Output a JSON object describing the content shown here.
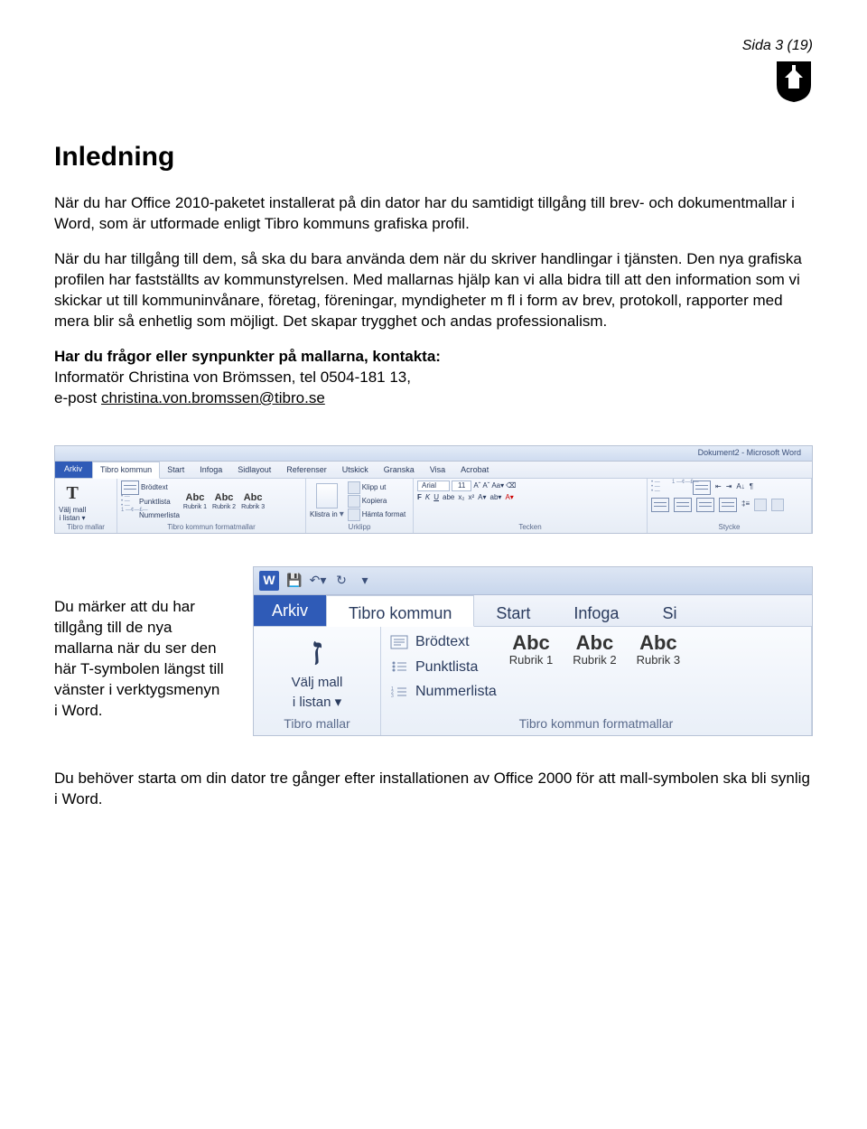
{
  "header": {
    "page_label": "Sida 3 (19)"
  },
  "title": "Inledning",
  "paragraphs": {
    "p1": "När du har Office 2010-paketet installerat på din dator har du samtidigt tillgång till brev- och dokumentmallar i Word, som är utformade enligt Tibro kommuns grafiska profil.",
    "p2": "När du har tillgång till dem, så ska du bara använda dem när du skriver handlingar i tjänsten. Den nya grafiska profilen har fastställts av kommunstyrelsen. Med mallarnas hjälp kan vi alla bidra till att den information som vi skickar ut till kommuninvånare, företag, föreningar, myndigheter m fl i form av brev, protokoll, rapporter med mera blir så enhetlig som möjligt. Det skapar trygghet och andas professionalism.",
    "contact_heading": "Har du frågor eller synpunkter på mallarna, kontakta:",
    "contact_line1": "Informatör Christina von Brömssen, tel 0504-181 13,",
    "contact_line2a": "e-post ",
    "contact_email": "christina.von.bromssen@tibro.se"
  },
  "ribbon": {
    "window_title": "Dokument2 - Microsoft Word",
    "tabs": [
      "Arkiv",
      "Tibro kommun",
      "Start",
      "Infoga",
      "Sidlayout",
      "Referenser",
      "Utskick",
      "Granska",
      "Visa",
      "Acrobat"
    ],
    "group1": {
      "valj": "Välj mall",
      "ilistan": "i listan ▾",
      "list": [
        "Brödtext",
        "Punktlista",
        "Nummerlista"
      ],
      "label1": "Tibro mallar",
      "abc_cols": [
        {
          "top": "Abc",
          "sub": "Rubrik 1"
        },
        {
          "top": "Abc",
          "sub": "Rubrik 2"
        },
        {
          "top": "Abc",
          "sub": "Rubrik 3"
        }
      ],
      "label2": "Tibro kommun formatmallar"
    },
    "clip": {
      "paste": "Klistra in",
      "cut": "Klipp ut",
      "copy": "Kopiera",
      "format": "Hämta format",
      "label": "Urklipp"
    },
    "font": {
      "name": "Arial",
      "size": "11",
      "label": "Tecken"
    },
    "para": {
      "label": "Stycke"
    }
  },
  "caption": "Du märker att du har tillgång till de nya mallarna när du ser den här T-symbolen längst till vänster i verktygsmenyn i Word.",
  "zoom": {
    "qat": {
      "w": "W"
    },
    "tabs": [
      "Arkiv",
      "Tibro kommun",
      "Start",
      "Infoga",
      "Si"
    ],
    "group_a": {
      "valj": "Välj mall",
      "ilistan": "i listan ▾",
      "label": "Tibro mallar"
    },
    "group_b": {
      "list": [
        "Brödtext",
        "Punktlista",
        "Nummerlista"
      ],
      "abc_cols": [
        {
          "top": "Abc",
          "sub": "Rubrik 1"
        },
        {
          "top": "Abc",
          "sub": "Rubrik 2"
        },
        {
          "top": "Abc",
          "sub": "Rubrik 3"
        }
      ],
      "label": "Tibro kommun formatmallar"
    }
  },
  "footer_para": "Du behöver starta om din dator tre gånger efter installationen av Office 2000 för att mall-symbolen ska bli synlig i Word."
}
